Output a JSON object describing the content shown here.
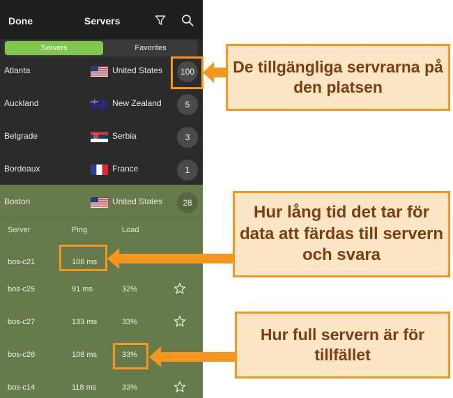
{
  "header": {
    "done_label": "Done",
    "title": "Servers",
    "filter_icon": "filter-icon",
    "search_icon": "search-icon"
  },
  "tabs": {
    "active": "Servers",
    "inactive": "Favorites"
  },
  "locations": [
    {
      "city": "Atlanta",
      "country": "United States",
      "flag": "us",
      "count": "100"
    },
    {
      "city": "Auckland",
      "country": "New Zealand",
      "flag": "nz",
      "count": "5"
    },
    {
      "city": "Belgrade",
      "country": "Serbia",
      "flag": "rs",
      "count": "3"
    },
    {
      "city": "Bordeaux",
      "country": "France",
      "flag": "fr",
      "count": "1"
    },
    {
      "city": "Boston",
      "country": "United States",
      "flag": "us",
      "count": "28"
    }
  ],
  "server_table": {
    "columns": [
      "Server",
      "Ping",
      "Load"
    ],
    "rows": [
      {
        "server": "bos-c21",
        "ping": "106 ms",
        "load": ""
      },
      {
        "server": "bos-c25",
        "ping": "91 ms",
        "load": "32%"
      },
      {
        "server": "bos-c27",
        "ping": "133 ms",
        "load": "33%"
      },
      {
        "server": "bos-c26",
        "ping": "108 ms",
        "load": "33%"
      },
      {
        "server": "bos-c14",
        "ping": "118 ms",
        "load": "33%"
      }
    ]
  },
  "callouts": {
    "available": "De tillgängliga servrarna på den platsen",
    "ping": "Hur lång tid det tar för data att färdas till servern och svara",
    "load": "Hur full servern är för tillfället"
  },
  "colors": {
    "accent": "#7fc74e",
    "annotation": "#f5961e",
    "callout_bg": "#fde6c6",
    "callout_text": "#7a3e12"
  }
}
